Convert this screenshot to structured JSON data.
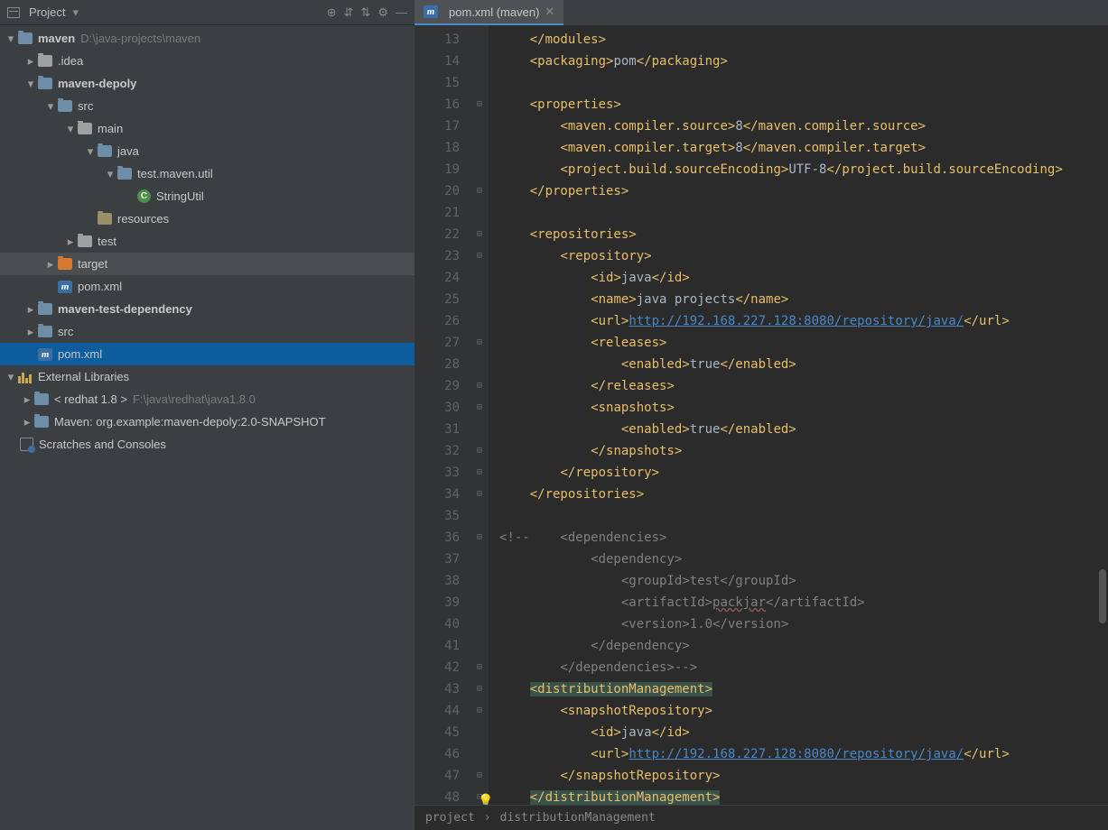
{
  "sidebar": {
    "title": "Project",
    "rootName": "maven",
    "rootPath": "D:\\java-projects\\maven",
    "nodes": [
      {
        "indent": 1,
        "arrow": ">",
        "icon": "folder",
        "label": ".idea"
      },
      {
        "indent": 1,
        "arrow": "v",
        "icon": "folder-mod",
        "label": "maven-depoly",
        "bold": true
      },
      {
        "indent": 2,
        "arrow": "v",
        "icon": "folder-mod",
        "label": "src"
      },
      {
        "indent": 3,
        "arrow": "v",
        "icon": "folder",
        "label": "main"
      },
      {
        "indent": 4,
        "arrow": "v",
        "icon": "folder-pkg",
        "label": "java"
      },
      {
        "indent": 5,
        "arrow": "v",
        "icon": "folder-pkg",
        "label": "test.maven.util"
      },
      {
        "indent": 6,
        "arrow": " ",
        "icon": "class",
        "label": "StringUtil"
      },
      {
        "indent": 4,
        "arrow": " ",
        "icon": "folder-res",
        "label": "resources"
      },
      {
        "indent": 3,
        "arrow": ">",
        "icon": "folder",
        "label": "test"
      },
      {
        "indent": 2,
        "arrow": ">",
        "icon": "folder-excl",
        "label": "target",
        "sel": "dark"
      },
      {
        "indent": 2,
        "arrow": " ",
        "icon": "m",
        "label": "pom.xml"
      },
      {
        "indent": 1,
        "arrow": ">",
        "icon": "folder-mod",
        "label": "maven-test-dependency",
        "bold": true
      },
      {
        "indent": 1,
        "arrow": ">",
        "icon": "folder-mod",
        "label": "src"
      },
      {
        "indent": 1,
        "arrow": " ",
        "icon": "m",
        "label": "pom.xml",
        "sel": "blue"
      }
    ],
    "extLibs": "External Libraries",
    "jdk": "< redhat 1.8 >",
    "jdkPath": "F:\\java\\redhat\\java1.8.0",
    "mavenLib": "Maven: org.example:maven-depoly:2.0-SNAPSHOT",
    "scratches": "Scratches and Consoles"
  },
  "tab": {
    "label": "pom.xml (maven)"
  },
  "code": {
    "url1": "http://192.168.227.128:8080/repository/java/",
    "url2": "http://192.168.227.128:8080/repository/java/",
    "packjar": "packjar",
    "lines": [
      {
        "n": 13,
        "html": "    <t></modules></t>"
      },
      {
        "n": 14,
        "html": "    <t><packaging></t>pom<t></packaging></t>"
      },
      {
        "n": 15,
        "html": ""
      },
      {
        "n": 16,
        "html": "    <t><properties></t>"
      },
      {
        "n": 17,
        "html": "        <t><maven.compiler.source></t>8<t></maven.compiler.source></t>"
      },
      {
        "n": 18,
        "html": "        <t><maven.compiler.target></t>8<t></maven.compiler.target></t>"
      },
      {
        "n": 19,
        "html": "        <t><project.build.sourceEncoding></t>UTF-8<t></project.build.sourceEncoding></t>"
      },
      {
        "n": 20,
        "html": "    <t></properties></t>"
      },
      {
        "n": 21,
        "html": ""
      },
      {
        "n": 22,
        "html": "    <t><repositories></t>"
      },
      {
        "n": 23,
        "html": "        <t><repository></t>"
      },
      {
        "n": 24,
        "html": "            <t><id></t>java<t></id></t>"
      },
      {
        "n": 25,
        "html": "            <t><name></t>java projects<t></name></t>"
      },
      {
        "n": 26,
        "html": "            <t><url></t><u1><t></url></t>"
      },
      {
        "n": 27,
        "html": "            <t><releases></t>"
      },
      {
        "n": 28,
        "html": "                <t><enabled></t>true<t></enabled></t>"
      },
      {
        "n": 29,
        "html": "            <t></releases></t>"
      },
      {
        "n": 30,
        "html": "            <t><snapshots></t>"
      },
      {
        "n": 31,
        "html": "                <t><enabled></t>true<t></enabled></t>"
      },
      {
        "n": 32,
        "html": "            <t></snapshots></t>"
      },
      {
        "n": 33,
        "html": "        <t></repository></t>"
      },
      {
        "n": 34,
        "html": "    <t></repositories></t>"
      },
      {
        "n": 35,
        "html": ""
      },
      {
        "n": 36,
        "html": "<c><!--    <dependencies></c>"
      },
      {
        "n": 37,
        "html": "<c>            <dependency></c>"
      },
      {
        "n": 38,
        "html": "<c>                <groupId>test</groupId></c>"
      },
      {
        "n": 39,
        "html": "<c>                <artifactId></c><pj><c></artifactId></c>"
      },
      {
        "n": 40,
        "html": "<c>                <version>1.0</version></c>"
      },
      {
        "n": 41,
        "html": "<c>            </dependency></c>"
      },
      {
        "n": 42,
        "html": "<c>        </dependencies>--></c>"
      },
      {
        "n": 43,
        "html": "    <h><t><distributionManagement></t></h>"
      },
      {
        "n": 44,
        "html": "        <t><snapshotRepository></t>"
      },
      {
        "n": 45,
        "html": "            <t><id></t>java<t></id></t>"
      },
      {
        "n": 46,
        "html": "            <t><url></t><u2><t></url></t>"
      },
      {
        "n": 47,
        "html": "        <t></snapshotRepository></t>"
      },
      {
        "n": 48,
        "html": "    <h><t></distributionManagement></t></h>",
        "cursor": true
      }
    ]
  },
  "breadcrumb": {
    "p1": "project",
    "p2": "distributionManagement"
  }
}
